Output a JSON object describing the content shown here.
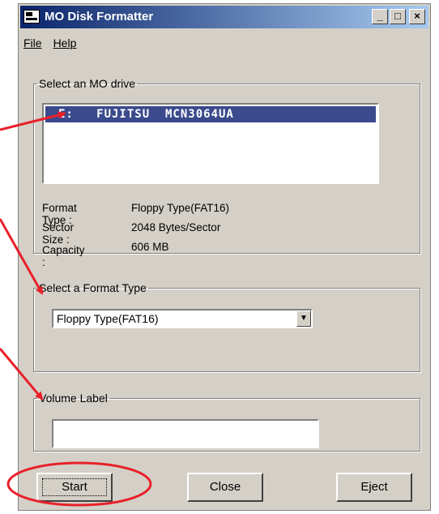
{
  "window": {
    "title": "MO Disk Formatter",
    "controls": {
      "minimize": "_",
      "maximize": "□",
      "close": "×"
    }
  },
  "menu": {
    "file": "File",
    "help": "Help"
  },
  "drive_group": {
    "legend": "Select an MO drive",
    "drives": [
      {
        "label": "E:   FUJITSU  MCN3064UA"
      }
    ]
  },
  "info": {
    "format_type_label": "Format Type :",
    "format_type_value": "Floppy Type(FAT16)",
    "sector_size_label": "Sector Size :",
    "sector_size_value": "2048 Bytes/Sector",
    "capacity_label": "Capacity :",
    "capacity_value": "606 MB"
  },
  "format_group": {
    "legend": "Select a Format Type",
    "selected": "Floppy Type(FAT16)"
  },
  "volume_group": {
    "legend": "Volume Label",
    "value": ""
  },
  "buttons": {
    "start": "Start",
    "close": "Close",
    "eject": "Eject"
  },
  "annotations": {
    "arrow_color": "#e8202a"
  }
}
